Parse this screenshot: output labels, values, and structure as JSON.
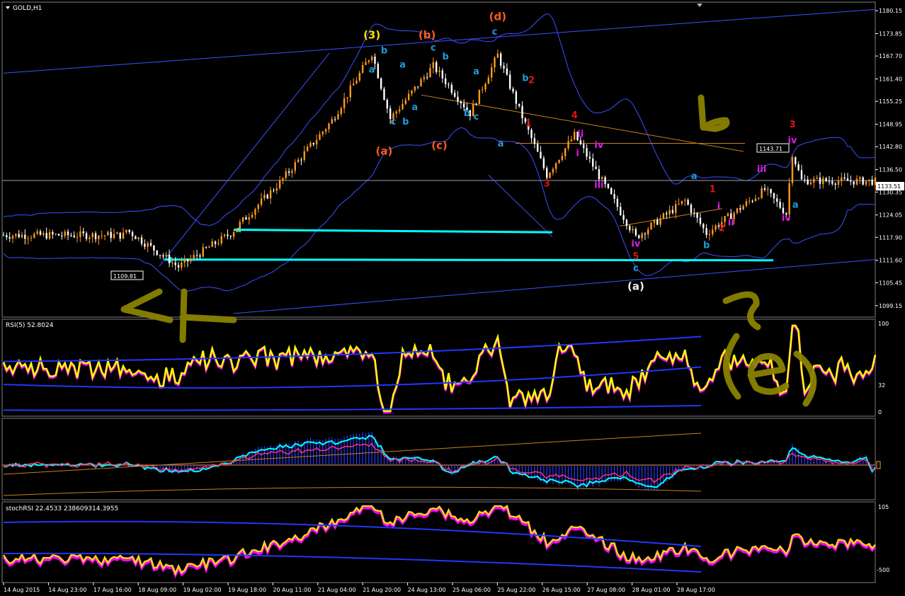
{
  "window": {
    "title": "GOLD,H1"
  },
  "price_panel": {
    "yticks": [
      "1180.15",
      "1173.85",
      "1167.70",
      "1161.40",
      "1155.25",
      "1148.95",
      "1142.80",
      "1136.50",
      "1130.35",
      "1124.05",
      "1117.90",
      "1111.60",
      "1105.45",
      "1099.15"
    ],
    "current_price": "1133.51",
    "level_label": "1143.71",
    "low_label": "1109.81"
  },
  "rsi_panel": {
    "title": "RSI(5) 52.8024",
    "yticks": [
      "100",
      "32",
      "0"
    ]
  },
  "stoch_panel": {
    "title": "stochRSI 22.4533 238609314.3955",
    "yticks": [
      "105",
      "-500"
    ]
  },
  "x_axis": {
    "labels": [
      "14 Aug 2015",
      "14 Aug 23:00",
      "17 Aug 16:00",
      "18 Aug 09:00",
      "19 Aug 02:00",
      "19 Aug 18:00",
      "20 Aug 11:00",
      "21 Aug 04:00",
      "21 Aug 20:00",
      "24 Aug 13:00",
      "25 Aug 06:00",
      "25 Aug 22:00",
      "26 Aug 15:00",
      "27 Aug 08:00",
      "28 Aug 01:00",
      "28 Aug 17:00"
    ]
  },
  "annotations": [
    {
      "text": "(3)",
      "color": "#ffe000",
      "x": "21 Aug 00:00",
      "y": 1172.5,
      "size": "wave"
    },
    {
      "text": "(b)",
      "color": "#ff5a1e",
      "x": "21 Aug 18:00",
      "y": 1172.5,
      "size": "wave"
    },
    {
      "text": "(d)",
      "color": "#ff5a1e",
      "x": "24 Aug 13:00",
      "y": 1177.5,
      "size": "wave"
    },
    {
      "text": "(a)",
      "color": "#ff5a1e",
      "x": "21 Aug 04:00",
      "y": 1140.6,
      "size": "wave"
    },
    {
      "text": "(c)",
      "color": "#ff5a1e",
      "x": "22 Aug 08:00",
      "y": 1142.2,
      "size": "wave"
    },
    {
      "text": "(a)",
      "color": "#eeeeee",
      "x": "26 Aug 14:00",
      "y": 1103.5,
      "size": "wave"
    },
    {
      "text": "b",
      "color": "#1e9bd7",
      "x": "21 Aug 04:00",
      "y": 1168.4,
      "size": "small"
    },
    {
      "text": "a",
      "color": "#1e9bd7",
      "x": "21 Aug 00:00",
      "y": 1163.2,
      "size": "small"
    },
    {
      "text": "a",
      "color": "#1e9bd7",
      "x": "21 Aug 10:00",
      "y": 1164.5,
      "size": "small"
    },
    {
      "text": "c",
      "color": "#1e9bd7",
      "x": "21 Aug 20:00",
      "y": 1169.2,
      "size": "small"
    },
    {
      "text": "b",
      "color": "#1e9bd7",
      "x": "22 Aug 10:00",
      "y": 1166.8,
      "size": "small"
    },
    {
      "text": "a",
      "color": "#1e9bd7",
      "x": "22 Aug 20:00",
      "y": 1162.7,
      "size": "small"
    },
    {
      "text": "c",
      "color": "#1e9bd7",
      "x": "24 Aug 12:00",
      "y": 1173.6,
      "size": "small"
    },
    {
      "text": "b",
      "color": "#1e9bd7",
      "x": "24 Aug 22:00",
      "y": 1160.8,
      "size": "small"
    },
    {
      "text": "a",
      "color": "#1e9bd7",
      "x": "22 Aug 00:00",
      "y": 1152.9,
      "size": "small"
    },
    {
      "text": "c",
      "color": "#1e9bd7",
      "x": "21 Aug 07:00",
      "y": 1148.9,
      "size": "small"
    },
    {
      "text": "b",
      "color": "#1e9bd7",
      "x": "21 Aug 11:00",
      "y": 1148.9,
      "size": "small"
    },
    {
      "text": "c",
      "color": "#1e9bd7",
      "x": "22 Aug 20:00",
      "y": 1150.2,
      "size": "small"
    },
    {
      "text": "b",
      "color": "#1e9bd7",
      "x": "24 Aug 03:00",
      "y": 1151.2,
      "size": "small"
    },
    {
      "text": "a",
      "color": "#1e9bd7",
      "x": "24 Aug 14:00",
      "y": 1142.8,
      "size": "small"
    },
    {
      "text": "2",
      "color": "#dd1515",
      "x": "25 Aug 04:00",
      "y": 1160.2,
      "size": "small"
    },
    {
      "text": "1",
      "color": "#dd1515",
      "x": "25 Aug 03:00",
      "y": 1148.4,
      "size": "small"
    },
    {
      "text": "4",
      "color": "#dd1515",
      "x": "25 Aug 18:00",
      "y": 1150.6,
      "size": "small"
    },
    {
      "text": "3",
      "color": "#dd1515",
      "x": "25 Aug 09:00",
      "y": 1131.9,
      "size": "small"
    },
    {
      "text": "ii",
      "color": "#dd1ee0",
      "x": "25 Aug 20:00",
      "y": 1145.5,
      "size": "small"
    },
    {
      "text": "iv",
      "color": "#dd1ee0",
      "x": "26 Aug 02:00",
      "y": 1142.5,
      "size": "small"
    },
    {
      "text": "i",
      "color": "#dd1ee0",
      "x": "25 Aug 19:00",
      "y": 1140.2,
      "size": "small"
    },
    {
      "text": "iii",
      "color": "#dd1ee0",
      "x": "26 Aug 02:00",
      "y": 1131.5,
      "size": "small"
    },
    {
      "text": "iv",
      "color": "#dd1ee0",
      "x": "26 Aug 14:00",
      "y": 1115.3,
      "size": "small"
    },
    {
      "text": "5",
      "color": "#dd1515",
      "x": "26 Aug 14:00",
      "y": 1111.8,
      "size": "small"
    },
    {
      "text": "c",
      "color": "#1e9bd7",
      "x": "26 Aug 14:00",
      "y": 1108.6,
      "size": "small"
    },
    {
      "text": "a",
      "color": "#1e9bd7",
      "x": "27 Aug 09:00",
      "y": 1133.9,
      "size": "small"
    },
    {
      "text": "1",
      "color": "#dd1515",
      "x": "27 Aug 15:00",
      "y": 1130.3,
      "size": "small"
    },
    {
      "text": "i",
      "color": "#dd1ee0",
      "x": "27 Aug 17:00",
      "y": 1125.6,
      "size": "small"
    },
    {
      "text": "2",
      "color": "#dd1515",
      "x": "27 Aug 18:00",
      "y": 1119.6,
      "size": "small"
    },
    {
      "text": "ii",
      "color": "#dd1ee0",
      "x": "27 Aug 21:00",
      "y": 1121.2,
      "size": "small"
    },
    {
      "text": "b",
      "color": "#1e9bd7",
      "x": "27 Aug 13:00",
      "y": 1115.0,
      "size": "small"
    },
    {
      "text": "iii",
      "color": "#dd1ee0",
      "x": "28 Aug 07:00",
      "y": 1135.8,
      "size": "small"
    },
    {
      "text": "3",
      "color": "#dd1515",
      "x": "28 Aug 17:00",
      "y": 1148.1,
      "size": "small"
    },
    {
      "text": "iv",
      "color": "#dd1ee0",
      "x": "28 Aug 17:00",
      "y": 1143.7,
      "size": "small"
    },
    {
      "text": "a",
      "color": "#1e9bd7",
      "x": "28 Aug 18:00",
      "y": 1126.0,
      "size": "small"
    },
    {
      "text": "iv",
      "color": "#dd1ee0",
      "x": "28 Aug 15:00",
      "y": 1122.4,
      "size": "small"
    }
  ],
  "colors": {
    "up_candle": "#ff9a1e",
    "down_candle": "#ffffff",
    "bollinger": "#3b50ff",
    "channel": "#3b50ff",
    "arrow": "#00ffff",
    "resistance": "#c8801e",
    "handwriting": "#8a8200",
    "rsi_main": "#ffff00",
    "rsi_shadow": "#ff00ff"
  },
  "chart_data": [
    {
      "type": "candlestick",
      "symbol": "GOLD",
      "timeframe": "H1",
      "x_start": "14 Aug 2015",
      "x_end": "28 Aug 2015 20:00",
      "ylim": [
        1096.0,
        1182.5
      ],
      "key_points": [
        {
          "x": "14 Aug 2015 00:00",
          "close": 1118.5
        },
        {
          "x": "17 Aug 16:00",
          "close": 1120.0
        },
        {
          "x": "18 Aug 09:00",
          "low": 1109.81
        },
        {
          "x": "19 Aug 02:00",
          "close": 1119.0
        },
        {
          "x": "19 Aug 18:00",
          "close": 1133.0
        },
        {
          "x": "20 Aug 11:00",
          "close": 1150.0
        },
        {
          "x": "21 Aug 00:00",
          "high": 1168.5
        },
        {
          "x": "21 Aug 06:00",
          "low": 1150.5
        },
        {
          "x": "21 Aug 20:00",
          "high": 1165.0
        },
        {
          "x": "22 Aug 18:00",
          "low": 1152.0
        },
        {
          "x": "24 Aug 13:00",
          "high": 1168.0
        },
        {
          "x": "25 Aug 00:00",
          "close": 1153.0
        },
        {
          "x": "25 Aug 09:00",
          "low": 1135.0
        },
        {
          "x": "25 Aug 18:00",
          "high": 1146.0
        },
        {
          "x": "26 Aug 14:00",
          "low": 1117.9
        },
        {
          "x": "27 Aug 06:00",
          "close": 1128.0
        },
        {
          "x": "27 Aug 13:00",
          "low": 1119.0
        },
        {
          "x": "28 Aug 08:00",
          "close": 1131.0
        },
        {
          "x": "28 Aug 15:00",
          "low": 1124.5
        },
        {
          "x": "28 Aug 17:00",
          "high": 1141.0
        },
        {
          "x": "28 Aug 20:00",
          "close": 1133.51
        }
      ],
      "horizontal_levels": [
        1143.71,
        1133.51
      ],
      "price_labels": [
        "1143.71",
        "1109.81"
      ]
    },
    {
      "type": "line",
      "name": "RSI(5)",
      "value": 52.8024,
      "ylim": [
        0,
        100
      ]
    },
    {
      "type": "line",
      "name": "stochRSI",
      "values_printed": [
        22.4533,
        238609314.3955
      ]
    }
  ]
}
